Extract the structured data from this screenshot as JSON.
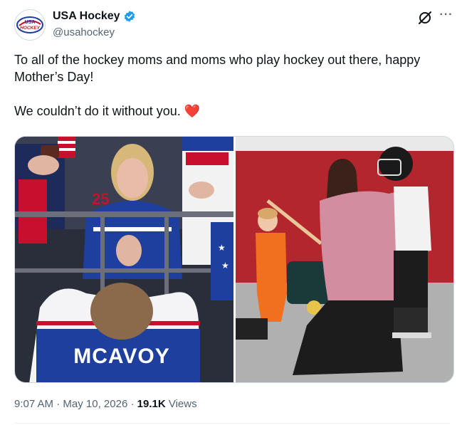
{
  "account": {
    "name": "USA Hockey",
    "handle": "@usahockey",
    "logo_text": "USA HOCKEY"
  },
  "tweet": {
    "line1": "To all of the hockey moms and moms who play hockey out there, happy Mother’s Day!",
    "line2": "We couldn’t do it without you.",
    "emoji": "❤️"
  },
  "media": {
    "left_photo": {
      "jersey_name": "MCAVOY",
      "jersey_number": "25"
    },
    "right_photo": {}
  },
  "meta": {
    "time": "9:07 AM",
    "separator": "·",
    "date": "May 10, 2026",
    "views_count": "19.1K",
    "views_label": "Views"
  },
  "icons": {
    "verified": "verified-badge-icon",
    "grok": "grok-icon",
    "more": "more-icon"
  },
  "colors": {
    "verified_blue": "#1d9bf0",
    "text_primary": "#0f1419",
    "text_secondary": "#536471",
    "heart_red": "#e0245e",
    "usa_blue": "#1f3f9e",
    "usa_red": "#c8102e"
  }
}
